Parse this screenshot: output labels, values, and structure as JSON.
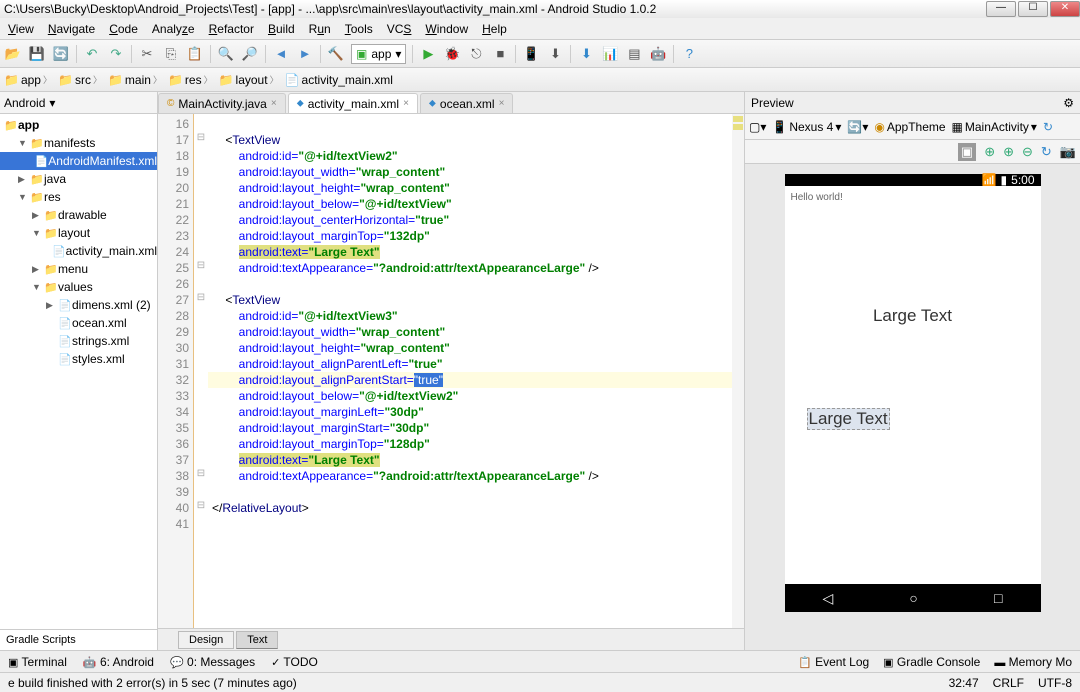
{
  "title": "C:\\Users\\Bucky\\Desktop\\Android_Projects\\Test] - [app] - ...\\app\\src\\main\\res\\layout\\activity_main.xml - Android Studio 1.0.2",
  "menu": {
    "view": "View",
    "navigate": "Navigate",
    "code": "Code",
    "analyze": "Analyze",
    "refactor": "Refactor",
    "build": "Build",
    "run": "Run",
    "tools": "Tools",
    "vcs": "VCS",
    "window": "Window",
    "help": "Help"
  },
  "toolbar": {
    "config": "app"
  },
  "breadcrumb": [
    "app",
    "src",
    "main",
    "res",
    "layout",
    "activity_main.xml"
  ],
  "sidebar": {
    "header": "Android",
    "root": "app",
    "items": [
      {
        "label": "manifests",
        "depth": 1,
        "toggle": "▼",
        "icon": "📁"
      },
      {
        "label": "AndroidManifest.xml",
        "depth": 2,
        "toggle": "",
        "icon": "📄",
        "sel": true
      },
      {
        "label": "java",
        "depth": 1,
        "toggle": "▶",
        "icon": "📁"
      },
      {
        "label": "res",
        "depth": 1,
        "toggle": "▼",
        "icon": "📁"
      },
      {
        "label": "drawable",
        "depth": 2,
        "toggle": "▶",
        "icon": "📁"
      },
      {
        "label": "layout",
        "depth": 2,
        "toggle": "▼",
        "icon": "📁"
      },
      {
        "label": "activity_main.xml",
        "depth": 3,
        "toggle": "",
        "icon": "📄"
      },
      {
        "label": "menu",
        "depth": 2,
        "toggle": "▶",
        "icon": "📁"
      },
      {
        "label": "values",
        "depth": 2,
        "toggle": "▼",
        "icon": "📁"
      },
      {
        "label": "dimens.xml (2)",
        "depth": 3,
        "toggle": "▶",
        "icon": "📄"
      },
      {
        "label": "ocean.xml",
        "depth": 3,
        "toggle": "",
        "icon": "📄"
      },
      {
        "label": "strings.xml",
        "depth": 3,
        "toggle": "",
        "icon": "📄"
      },
      {
        "label": "styles.xml",
        "depth": 3,
        "toggle": "",
        "icon": "📄"
      }
    ],
    "gradle": "Gradle Scripts"
  },
  "tabs": [
    {
      "label": "MainActivity.java",
      "icon": "©",
      "active": false
    },
    {
      "label": "activity_main.xml",
      "icon": "⬥",
      "active": true
    },
    {
      "label": "ocean.xml",
      "icon": "⬥",
      "active": false
    }
  ],
  "lines_start": 16,
  "code_lines": [
    {
      "n": 16,
      "html": ""
    },
    {
      "n": 17,
      "html": "    &lt;<span class='tag'>TextView</span>",
      "fold": "⊟"
    },
    {
      "n": 18,
      "html": "        <span class='attr'>android:id=</span><span class='val'>\"@+id/textView2\"</span>"
    },
    {
      "n": 19,
      "html": "        <span class='attr'>android:layout_width=</span><span class='val'>\"wrap_content\"</span>"
    },
    {
      "n": 20,
      "html": "        <span class='attr'>android:layout_height=</span><span class='val'>\"wrap_content\"</span>"
    },
    {
      "n": 21,
      "html": "        <span class='attr'>android:layout_below=</span><span class='val'>\"@+id/textView\"</span>"
    },
    {
      "n": 22,
      "html": "        <span class='attr'>android:layout_centerHorizontal=</span><span class='val'>\"true\"</span>"
    },
    {
      "n": 23,
      "html": "        <span class='attr'>android:layout_marginTop=</span><span class='val'>\"132dp\"</span>"
    },
    {
      "n": 24,
      "html": "        <span class='hl-yellow'><span class='attr'>android:text=</span><span class='val'>\"Large Text\"</span></span>"
    },
    {
      "n": 25,
      "html": "        <span class='attr'>android:textAppearance=</span><span class='val'>\"?android:attr/textAppearanceLarge\"</span> /&gt;",
      "fold": "⊟"
    },
    {
      "n": 26,
      "html": ""
    },
    {
      "n": 27,
      "html": "    &lt;<span class='tag'>TextView</span>",
      "fold": "⊟"
    },
    {
      "n": 28,
      "html": "        <span class='attr'>android:id=</span><span class='val'>\"@+id/textView3\"</span>"
    },
    {
      "n": 29,
      "html": "        <span class='attr'>android:layout_width=</span><span class='val'>\"wrap_content\"</span>"
    },
    {
      "n": 30,
      "html": "        <span class='attr'>android:layout_height=</span><span class='val'>\"wrap_content\"</span>"
    },
    {
      "n": 31,
      "html": "        <span class='attr'>android:layout_alignParentLeft=</span><span class='val'>\"true\"</span>"
    },
    {
      "n": 32,
      "html": "        <span class='attr'>android:layout_alignParentStart=</span><span class='sel'><span style='color:#fff'>\"true\"</span></span>",
      "hl": true
    },
    {
      "n": 33,
      "html": "        <span class='attr'>android:layout_below=</span><span class='val'>\"@+id/textView2\"</span>"
    },
    {
      "n": 34,
      "html": "        <span class='attr'>android:layout_marginLeft=</span><span class='val'>\"30dp\"</span>"
    },
    {
      "n": 35,
      "html": "        <span class='attr'>android:layout_marginStart=</span><span class='val'>\"30dp\"</span>"
    },
    {
      "n": 36,
      "html": "        <span class='attr'>android:layout_marginTop=</span><span class='val'>\"128dp\"</span>"
    },
    {
      "n": 37,
      "html": "        <span class='hl-yellow'><span class='attr'>android:text=</span><span class='val'>\"Large Text\"</span></span>"
    },
    {
      "n": 38,
      "html": "        <span class='attr'>android:textAppearance=</span><span class='val'>\"?android:attr/textAppearanceLarge\"</span> /&gt;",
      "fold": "⊟"
    },
    {
      "n": 39,
      "html": ""
    },
    {
      "n": 40,
      "html": "&lt;/<span class='tag'>RelativeLayout</span>&gt;",
      "fold": "⊟"
    },
    {
      "n": 41,
      "html": ""
    }
  ],
  "bottom_tabs": {
    "design": "Design",
    "text": "Text"
  },
  "preview": {
    "title": "Preview",
    "device": "Nexus 4",
    "theme": "AppTheme",
    "activity": "MainActivity",
    "status_time": "5:00",
    "hello": "Hello world!",
    "large1": "Large Text",
    "large2": "Large Text"
  },
  "status": {
    "terminal": "Terminal",
    "android": "6: Android",
    "messages": "0: Messages",
    "todo": "TODO",
    "eventlog": "Event Log",
    "gradle": "Gradle Console",
    "memory": "Memory Mo",
    "build": "e build finished with 2 error(s) in 5 sec (7 minutes ago)",
    "pos": "32:47",
    "crlf": "CRLF",
    "enc": "UTF-8"
  }
}
